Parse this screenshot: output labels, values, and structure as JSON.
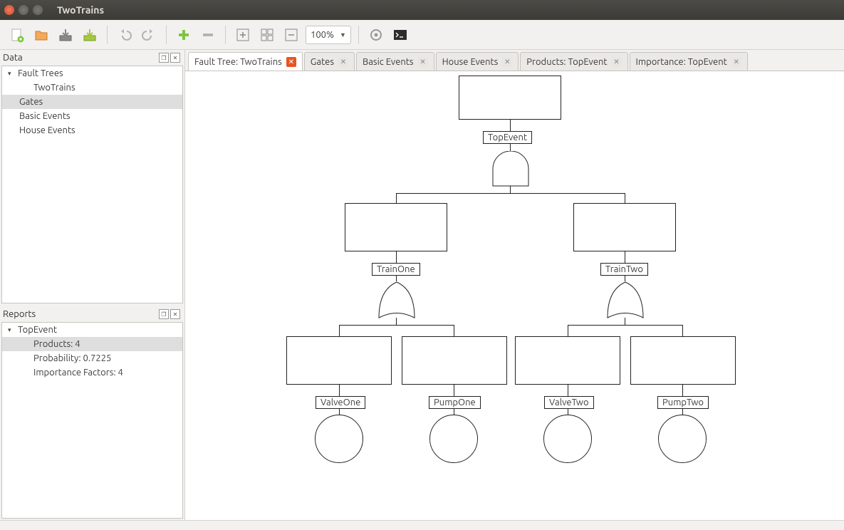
{
  "window": {
    "title": "TwoTrains"
  },
  "toolbar": {
    "zoom": "100%"
  },
  "sidebar": {
    "data_label": "Data",
    "reports_label": "Reports",
    "tree": {
      "root": "Fault Trees",
      "project": "TwoTrains",
      "gates": "Gates",
      "basic_events": "Basic Events",
      "house_events": "House Events"
    },
    "reports": {
      "root": "TopEvent",
      "products": "Products: 4",
      "probability": "Probability: 0.7225",
      "importance": "Importance Factors: 4"
    }
  },
  "tabs": [
    {
      "label": "Fault Tree: TwoTrains",
      "active": true,
      "closeStyle": "orange"
    },
    {
      "label": "Gates",
      "active": false
    },
    {
      "label": "Basic Events",
      "active": false
    },
    {
      "label": "House Events",
      "active": false
    },
    {
      "label": "Products: TopEvent",
      "active": false
    },
    {
      "label": "Importance: TopEvent",
      "active": false
    }
  ],
  "diagram": {
    "top": "TopEvent",
    "train_one": "TrainOne",
    "train_two": "TrainTwo",
    "valve_one": "ValveOne",
    "pump_one": "PumpOne",
    "valve_two": "ValveTwo",
    "pump_two": "PumpTwo"
  }
}
